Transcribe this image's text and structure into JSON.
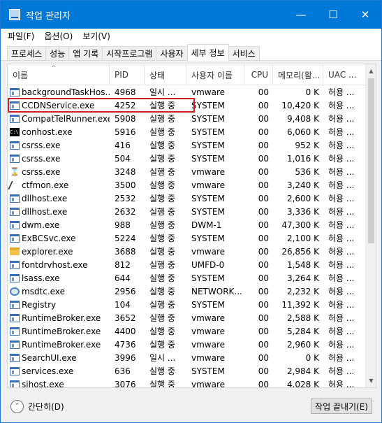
{
  "window": {
    "title": "작업 관리자",
    "minimize": "—",
    "maximize": "☐",
    "close": "✕"
  },
  "menu": [
    "파일(F)",
    "옵션(O)",
    "보기(V)"
  ],
  "tabs": [
    {
      "label": "프로세스",
      "active": false
    },
    {
      "label": "성능",
      "active": false
    },
    {
      "label": "앱 기록",
      "active": false
    },
    {
      "label": "시작프로그램",
      "active": false
    },
    {
      "label": "사용자",
      "active": false
    },
    {
      "label": "세부 정보",
      "active": true
    },
    {
      "label": "서비스",
      "active": false
    }
  ],
  "columns": {
    "name": "이름",
    "pid": "PID",
    "status": "상태",
    "user": "사용자 이름",
    "cpu": "CPU",
    "mem": "메모리(활...",
    "uac": "UAC ..."
  },
  "processes": [
    {
      "icon": "app-icon",
      "name": "backgroundTaskHos...",
      "pid": "4968",
      "status": "일시 ...",
      "user": "vmware",
      "cpu": "00",
      "mem": "0 K",
      "uac": "허용 ..."
    },
    {
      "icon": "app-icon",
      "name": "CCDNService.exe",
      "pid": "4252",
      "status": "실행 중",
      "user": "SYSTEM",
      "cpu": "00",
      "mem": "10,420 K",
      "uac": "허용 ..."
    },
    {
      "icon": "app-icon",
      "name": "CompatTelRunner.exe",
      "pid": "5908",
      "status": "실행 중",
      "user": "SYSTEM",
      "cpu": "00",
      "mem": "9,408 K",
      "uac": "허용 ..."
    },
    {
      "icon": "console-icon",
      "name": "conhost.exe",
      "pid": "5916",
      "status": "실행 중",
      "user": "SYSTEM",
      "cpu": "00",
      "mem": "6,060 K",
      "uac": "허용 ..."
    },
    {
      "icon": "app-icon",
      "name": "csrss.exe",
      "pid": "416",
      "status": "실행 중",
      "user": "SYSTEM",
      "cpu": "00",
      "mem": "952 K",
      "uac": "허용 ..."
    },
    {
      "icon": "app-icon",
      "name": "csrss.exe",
      "pid": "504",
      "status": "실행 중",
      "user": "SYSTEM",
      "cpu": "00",
      "mem": "1,016 K",
      "uac": "허용 ..."
    },
    {
      "icon": "busy-cursor-icon",
      "name": "csrss.exe",
      "pid": "3248",
      "status": "실행 중",
      "user": "vmware",
      "cpu": "00",
      "mem": "536 K",
      "uac": "허용 ..."
    },
    {
      "icon": "pen-icon",
      "name": "ctfmon.exe",
      "pid": "3500",
      "status": "실행 중",
      "user": "vmware",
      "cpu": "00",
      "mem": "3,240 K",
      "uac": "허용 ..."
    },
    {
      "icon": "app-icon",
      "name": "dllhost.exe",
      "pid": "2532",
      "status": "실행 중",
      "user": "SYSTEM",
      "cpu": "00",
      "mem": "2,600 K",
      "uac": "허용 ..."
    },
    {
      "icon": "app-icon",
      "name": "dllhost.exe",
      "pid": "2632",
      "status": "실행 중",
      "user": "SYSTEM",
      "cpu": "00",
      "mem": "3,336 K",
      "uac": "허용 ..."
    },
    {
      "icon": "app-icon",
      "name": "dwm.exe",
      "pid": "988",
      "status": "실행 중",
      "user": "DWM-1",
      "cpu": "00",
      "mem": "47,300 K",
      "uac": "허용 ..."
    },
    {
      "icon": "app-icon",
      "name": "ExBCSvc.exe",
      "pid": "5224",
      "status": "실행 중",
      "user": "SYSTEM",
      "cpu": "00",
      "mem": "2,100 K",
      "uac": "허용 ..."
    },
    {
      "icon": "folder-icon",
      "name": "explorer.exe",
      "pid": "3688",
      "status": "실행 중",
      "user": "vmware",
      "cpu": "00",
      "mem": "26,856 K",
      "uac": "허용 ..."
    },
    {
      "icon": "app-icon",
      "name": "fontdrvhost.exe",
      "pid": "812",
      "status": "실행 중",
      "user": "UMFD-0",
      "cpu": "00",
      "mem": "1,548 K",
      "uac": "허용 ..."
    },
    {
      "icon": "app-icon",
      "name": "lsass.exe",
      "pid": "644",
      "status": "실행 중",
      "user": "SYSTEM",
      "cpu": "00",
      "mem": "3,264 K",
      "uac": "허용 ..."
    },
    {
      "icon": "network-icon",
      "name": "msdtc.exe",
      "pid": "2956",
      "status": "실행 중",
      "user": "NETWORK...",
      "cpu": "00",
      "mem": "2,232 K",
      "uac": "허용 ..."
    },
    {
      "icon": "app-icon",
      "name": "Registry",
      "pid": "104",
      "status": "실행 중",
      "user": "SYSTEM",
      "cpu": "00",
      "mem": "11,392 K",
      "uac": "허용 ..."
    },
    {
      "icon": "app-icon",
      "name": "RuntimeBroker.exe",
      "pid": "3652",
      "status": "실행 중",
      "user": "vmware",
      "cpu": "00",
      "mem": "2,588 K",
      "uac": "허용 ..."
    },
    {
      "icon": "app-icon",
      "name": "RuntimeBroker.exe",
      "pid": "4400",
      "status": "실행 중",
      "user": "vmware",
      "cpu": "00",
      "mem": "5,284 K",
      "uac": "허용 ..."
    },
    {
      "icon": "app-icon",
      "name": "RuntimeBroker.exe",
      "pid": "4736",
      "status": "실행 중",
      "user": "vmware",
      "cpu": "00",
      "mem": "2,960 K",
      "uac": "허용 ..."
    },
    {
      "icon": "app-icon",
      "name": "SearchUI.exe",
      "pid": "3996",
      "status": "일시 ...",
      "user": "vmware",
      "cpu": "00",
      "mem": "0 K",
      "uac": "허용 ..."
    },
    {
      "icon": "app-icon",
      "name": "services.exe",
      "pid": "636",
      "status": "실행 중",
      "user": "SYSTEM",
      "cpu": "00",
      "mem": "2,984 K",
      "uac": "허용 ..."
    },
    {
      "icon": "app-icon",
      "name": "sihost.exe",
      "pid": "3076",
      "status": "실행 중",
      "user": "vmware",
      "cpu": "00",
      "mem": "4,028 K",
      "uac": "허용 ..."
    }
  ],
  "footer": {
    "fewer_details": "간단히(D)",
    "end_task": "작업 끝내기(E)"
  }
}
